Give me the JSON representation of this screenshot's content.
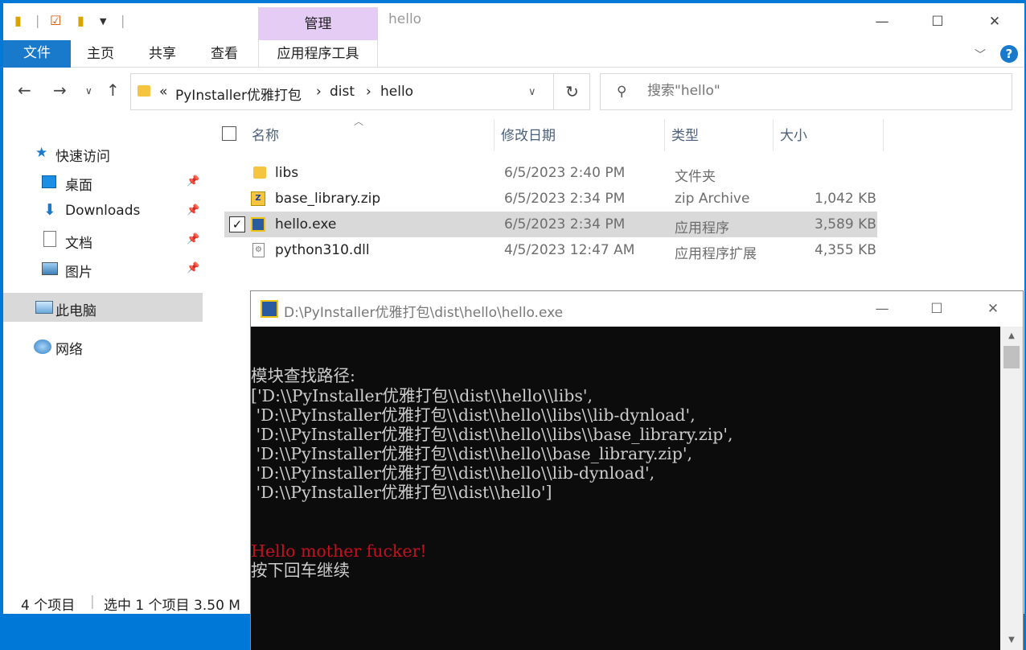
{
  "explorer": {
    "title": "hello",
    "manage_tab": "管理",
    "ribbon": {
      "file": "文件",
      "home": "主页",
      "share": "共享",
      "view": "查看",
      "app_tools": "应用程序工具"
    },
    "window_controls": {
      "minimize": "—",
      "maximize": "☐",
      "close": "✕"
    },
    "address": {
      "overflow": "«",
      "crumbs": [
        "PyInstaller优雅打包",
        "dist",
        "hello"
      ],
      "separator": "›"
    },
    "search": {
      "placeholder": "搜索\"hello\""
    },
    "sidebar": {
      "quick_access": "快速访问",
      "items": [
        {
          "label": "桌面",
          "pinned": true
        },
        {
          "label": "Downloads",
          "pinned": true
        },
        {
          "label": "文档",
          "pinned": true
        },
        {
          "label": "图片",
          "pinned": true
        }
      ],
      "this_pc": "此电脑",
      "network": "网络"
    },
    "columns": {
      "name": "名称",
      "modified": "修改日期",
      "type": "类型",
      "size": "大小"
    },
    "files": [
      {
        "name": "libs",
        "modified": "6/5/2023 2:40 PM",
        "type": "文件夹",
        "size": "",
        "icon": "folder-icon"
      },
      {
        "name": "base_library.zip",
        "modified": "6/5/2023 2:34 PM",
        "type": "zip Archive",
        "size": "1,042 KB",
        "icon": "zip-file-icon"
      },
      {
        "name": "hello.exe",
        "modified": "6/5/2023 2:34 PM",
        "type": "应用程序",
        "size": "3,589 KB",
        "icon": "exe-file-icon",
        "selected": true
      },
      {
        "name": "python310.dll",
        "modified": "4/5/2023 12:47 AM",
        "type": "应用程序扩展",
        "size": "4,355 KB",
        "icon": "dll-file-icon"
      }
    ],
    "status": {
      "count": "4 个项目",
      "selection": "选中 1 个项目  3.50 M"
    }
  },
  "console": {
    "title": "D:\\PyInstaller优雅打包\\dist\\hello\\hello.exe",
    "lines": [
      "模块查找路径:",
      "['D:\\\\PyInstaller优雅打包\\\\dist\\\\hello\\\\libs',",
      " 'D:\\\\PyInstaller优雅打包\\\\dist\\\\hello\\\\libs\\\\lib-dynload',",
      " 'D:\\\\PyInstaller优雅打包\\\\dist\\\\hello\\\\libs\\\\base_library.zip',",
      " 'D:\\\\PyInstaller优雅打包\\\\dist\\\\hello\\\\base_library.zip',",
      " 'D:\\\\PyInstaller优雅打包\\\\dist\\\\hello\\\\lib-dynload',",
      " 'D:\\\\PyInstaller优雅打包\\\\dist\\\\hello']"
    ],
    "hello_line": "Hello mother fucker!",
    "prompt_line": "按下回车继续"
  },
  "colors": {
    "desktop": "#0078d7",
    "ribbon_file": "#1979ca",
    "manage_tab": "#e5ccf5",
    "console_bg": "#0c0c0c",
    "console_text": "#cccccc",
    "console_red": "#c50f1f"
  }
}
